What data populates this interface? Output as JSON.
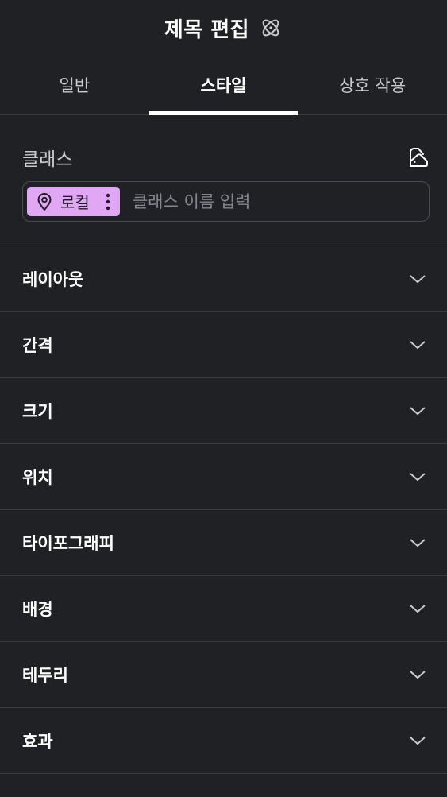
{
  "header": {
    "title": "제목 편집",
    "icon": "atom-icon"
  },
  "tabs": [
    {
      "label": "일반",
      "active": false
    },
    {
      "label": "스타일",
      "active": true
    },
    {
      "label": "상호 작용",
      "active": false
    }
  ],
  "classes": {
    "label": "클래스",
    "action_icon": "class-manager-icon",
    "chip": {
      "label": "로컬",
      "icon": "location-pin-icon",
      "color": "#e1a7f5"
    },
    "input_placeholder": "클래스 이름 입력",
    "input_value": ""
  },
  "sections": [
    {
      "label": "레이아웃"
    },
    {
      "label": "간격"
    },
    {
      "label": "크기"
    },
    {
      "label": "위치"
    },
    {
      "label": "타이포그래피"
    },
    {
      "label": "배경"
    },
    {
      "label": "테두리"
    },
    {
      "label": "효과"
    }
  ],
  "colors": {
    "background": "#202125",
    "divider": "#3a3b40",
    "text": "#ffffff",
    "muted_text": "#c9c9cc",
    "placeholder": "#85868c"
  }
}
